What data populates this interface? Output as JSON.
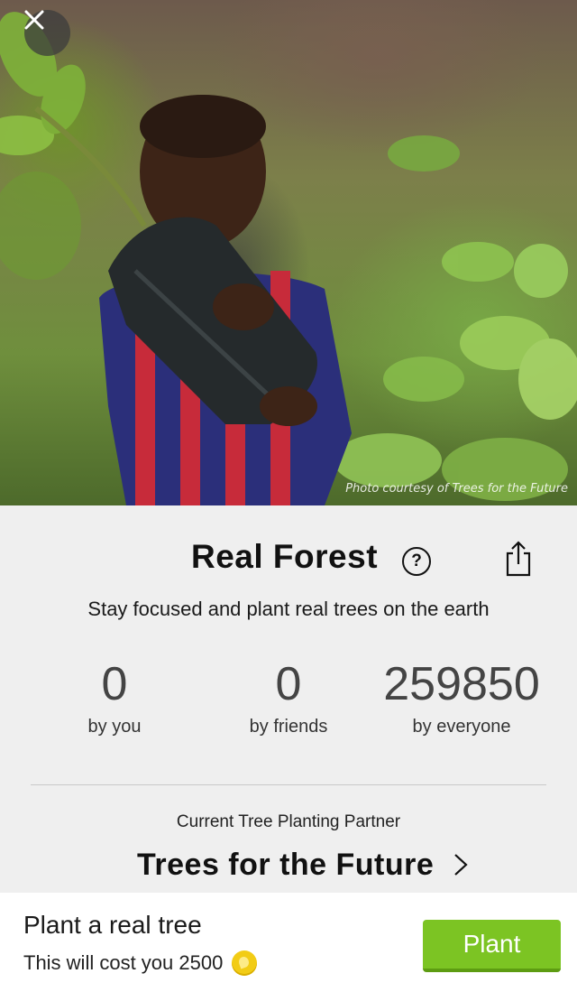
{
  "hero": {
    "photo_credit": "Photo courtesy of Trees for the Future",
    "close_icon": "close-icon"
  },
  "header": {
    "title": "Real Forest",
    "help_icon": "question-circle-icon",
    "help_glyph": "?",
    "share_icon": "share-icon"
  },
  "subtitle": "Stay focused and plant real trees on the earth",
  "stats": [
    {
      "value": "0",
      "label": "by you"
    },
    {
      "value": "0",
      "label": "by friends"
    },
    {
      "value": "259850",
      "label": "by everyone"
    }
  ],
  "partner": {
    "caption": "Current Tree Planting Partner",
    "name": "Trees for the Future",
    "chevron_icon": "chevron-right-icon"
  },
  "footer": {
    "title": "Plant a real tree",
    "cost_text": "This will cost you 2500",
    "coin_icon": "coin-icon",
    "button_label": "Plant"
  },
  "colors": {
    "accent_green": "#7cc423",
    "coin_yellow": "#f2cc16",
    "panel_bg": "#efefef"
  }
}
